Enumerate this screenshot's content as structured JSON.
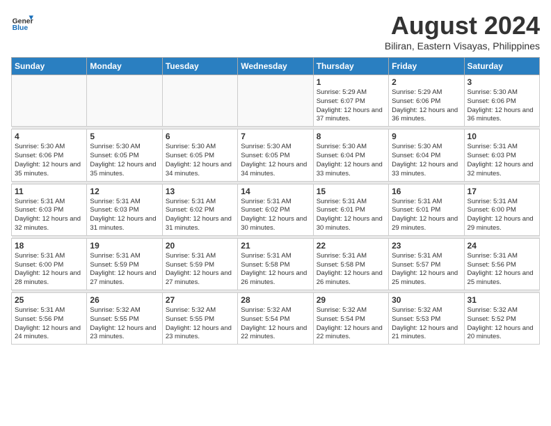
{
  "header": {
    "logo_general": "General",
    "logo_blue": "Blue",
    "month_year": "August 2024",
    "location": "Biliran, Eastern Visayas, Philippines"
  },
  "weekdays": [
    "Sunday",
    "Monday",
    "Tuesday",
    "Wednesday",
    "Thursday",
    "Friday",
    "Saturday"
  ],
  "weeks": [
    [
      {
        "day": "",
        "info": ""
      },
      {
        "day": "",
        "info": ""
      },
      {
        "day": "",
        "info": ""
      },
      {
        "day": "",
        "info": ""
      },
      {
        "day": "1",
        "info": "Sunrise: 5:29 AM\nSunset: 6:07 PM\nDaylight: 12 hours\nand 37 minutes."
      },
      {
        "day": "2",
        "info": "Sunrise: 5:29 AM\nSunset: 6:06 PM\nDaylight: 12 hours\nand 36 minutes."
      },
      {
        "day": "3",
        "info": "Sunrise: 5:30 AM\nSunset: 6:06 PM\nDaylight: 12 hours\nand 36 minutes."
      }
    ],
    [
      {
        "day": "4",
        "info": "Sunrise: 5:30 AM\nSunset: 6:06 PM\nDaylight: 12 hours\nand 35 minutes."
      },
      {
        "day": "5",
        "info": "Sunrise: 5:30 AM\nSunset: 6:05 PM\nDaylight: 12 hours\nand 35 minutes."
      },
      {
        "day": "6",
        "info": "Sunrise: 5:30 AM\nSunset: 6:05 PM\nDaylight: 12 hours\nand 34 minutes."
      },
      {
        "day": "7",
        "info": "Sunrise: 5:30 AM\nSunset: 6:05 PM\nDaylight: 12 hours\nand 34 minutes."
      },
      {
        "day": "8",
        "info": "Sunrise: 5:30 AM\nSunset: 6:04 PM\nDaylight: 12 hours\nand 33 minutes."
      },
      {
        "day": "9",
        "info": "Sunrise: 5:30 AM\nSunset: 6:04 PM\nDaylight: 12 hours\nand 33 minutes."
      },
      {
        "day": "10",
        "info": "Sunrise: 5:31 AM\nSunset: 6:03 PM\nDaylight: 12 hours\nand 32 minutes."
      }
    ],
    [
      {
        "day": "11",
        "info": "Sunrise: 5:31 AM\nSunset: 6:03 PM\nDaylight: 12 hours\nand 32 minutes."
      },
      {
        "day": "12",
        "info": "Sunrise: 5:31 AM\nSunset: 6:03 PM\nDaylight: 12 hours\nand 31 minutes."
      },
      {
        "day": "13",
        "info": "Sunrise: 5:31 AM\nSunset: 6:02 PM\nDaylight: 12 hours\nand 31 minutes."
      },
      {
        "day": "14",
        "info": "Sunrise: 5:31 AM\nSunset: 6:02 PM\nDaylight: 12 hours\nand 30 minutes."
      },
      {
        "day": "15",
        "info": "Sunrise: 5:31 AM\nSunset: 6:01 PM\nDaylight: 12 hours\nand 30 minutes."
      },
      {
        "day": "16",
        "info": "Sunrise: 5:31 AM\nSunset: 6:01 PM\nDaylight: 12 hours\nand 29 minutes."
      },
      {
        "day": "17",
        "info": "Sunrise: 5:31 AM\nSunset: 6:00 PM\nDaylight: 12 hours\nand 29 minutes."
      }
    ],
    [
      {
        "day": "18",
        "info": "Sunrise: 5:31 AM\nSunset: 6:00 PM\nDaylight: 12 hours\nand 28 minutes."
      },
      {
        "day": "19",
        "info": "Sunrise: 5:31 AM\nSunset: 5:59 PM\nDaylight: 12 hours\nand 27 minutes."
      },
      {
        "day": "20",
        "info": "Sunrise: 5:31 AM\nSunset: 5:59 PM\nDaylight: 12 hours\nand 27 minutes."
      },
      {
        "day": "21",
        "info": "Sunrise: 5:31 AM\nSunset: 5:58 PM\nDaylight: 12 hours\nand 26 minutes."
      },
      {
        "day": "22",
        "info": "Sunrise: 5:31 AM\nSunset: 5:58 PM\nDaylight: 12 hours\nand 26 minutes."
      },
      {
        "day": "23",
        "info": "Sunrise: 5:31 AM\nSunset: 5:57 PM\nDaylight: 12 hours\nand 25 minutes."
      },
      {
        "day": "24",
        "info": "Sunrise: 5:31 AM\nSunset: 5:56 PM\nDaylight: 12 hours\nand 25 minutes."
      }
    ],
    [
      {
        "day": "25",
        "info": "Sunrise: 5:31 AM\nSunset: 5:56 PM\nDaylight: 12 hours\nand 24 minutes."
      },
      {
        "day": "26",
        "info": "Sunrise: 5:32 AM\nSunset: 5:55 PM\nDaylight: 12 hours\nand 23 minutes."
      },
      {
        "day": "27",
        "info": "Sunrise: 5:32 AM\nSunset: 5:55 PM\nDaylight: 12 hours\nand 23 minutes."
      },
      {
        "day": "28",
        "info": "Sunrise: 5:32 AM\nSunset: 5:54 PM\nDaylight: 12 hours\nand 22 minutes."
      },
      {
        "day": "29",
        "info": "Sunrise: 5:32 AM\nSunset: 5:54 PM\nDaylight: 12 hours\nand 22 minutes."
      },
      {
        "day": "30",
        "info": "Sunrise: 5:32 AM\nSunset: 5:53 PM\nDaylight: 12 hours\nand 21 minutes."
      },
      {
        "day": "31",
        "info": "Sunrise: 5:32 AM\nSunset: 5:52 PM\nDaylight: 12 hours\nand 20 minutes."
      }
    ]
  ]
}
